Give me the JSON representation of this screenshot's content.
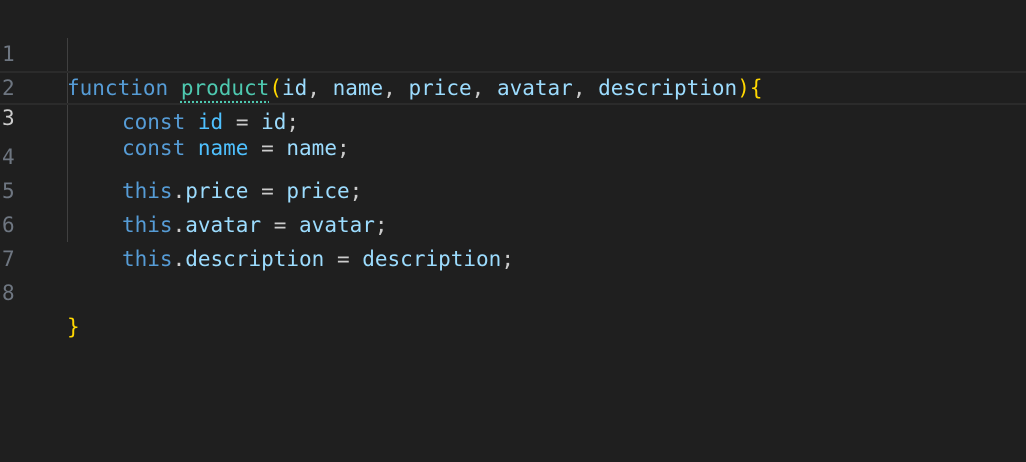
{
  "editor": {
    "active_line": 3,
    "colors": {
      "background": "#1f1f1f",
      "keyword": "#569cd6",
      "function_name": "#4ec9b0",
      "identifier": "#9cdcfe",
      "brace": "#ffd700",
      "gutter": "#6e7681"
    },
    "lines": [
      {
        "number": "1"
      },
      {
        "number": "2"
      },
      {
        "number": "3"
      },
      {
        "number": "4"
      },
      {
        "number": "5"
      },
      {
        "number": "6"
      },
      {
        "number": "7"
      },
      {
        "number": "8"
      }
    ],
    "tokens": {
      "l1_kw": "function",
      "l1_fn": "product",
      "l1_open": "(",
      "l1_p1": "id",
      "l1_p2": "name",
      "l1_p3": "price",
      "l1_p4": "avatar",
      "l1_p5": "description",
      "l1_close": ")",
      "l1_brace": "{",
      "l2_kw": "const",
      "l2_var": "id",
      "l2_val": "id",
      "l3_kw": "const",
      "l3_var": "name",
      "l3_val": "name",
      "l4_this": "this",
      "l4_prop": "price",
      "l4_val": "price",
      "l5_this": "this",
      "l5_prop": "avatar",
      "l5_val": "avatar",
      "l6_this": "this",
      "l6_prop": "description",
      "l6_val": "description",
      "l8_brace": "}"
    }
  }
}
